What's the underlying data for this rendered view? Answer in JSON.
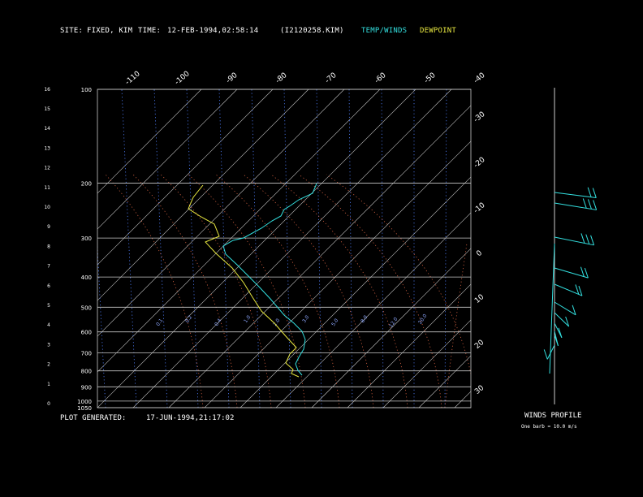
{
  "header": {
    "site_label": "SITE:",
    "site_value": "FIXED, KIM",
    "time_label": "TIME:",
    "time_value": "12-FEB-1994,02:58:14",
    "file": "(I2120258.KIM)",
    "legend_temp": "TEMP/WINDS",
    "legend_dew": "DEWPOINT"
  },
  "footer": {
    "generated_label": "PLOT GENERATED:",
    "generated_value": "17-JUN-1994,21:17:02",
    "winds_title": "WINDS PROFILE",
    "barb_note": "One barb = 10.0 m/s"
  },
  "colors": {
    "temp": "#33e0e0",
    "dew": "#e8e840",
    "grid": "#c8c8c8",
    "mixing": "#5080ff",
    "adiabat": "#d06040"
  },
  "chart_data": {
    "type": "line",
    "title": "",
    "xlabel": "",
    "ylabel": "",
    "grid": true,
    "pressure_levels": [
      100,
      200,
      300,
      400,
      500,
      600,
      700,
      800,
      900,
      1000,
      1050
    ],
    "height_ticks": [
      0,
      1,
      2,
      3,
      4,
      5,
      6,
      7,
      8,
      9,
      10,
      11,
      12,
      13,
      14,
      15,
      16
    ],
    "top_temp_labels": [
      -110,
      -100,
      -90,
      -80,
      -70,
      -60,
      -50,
      -40
    ],
    "right_temp_labels": [
      -30,
      -20,
      -10,
      0,
      10,
      20,
      30
    ],
    "mixing_ratio_labels": [
      "0.1",
      "0.2",
      "0.4",
      "1.0",
      "2.0",
      "3.0",
      "5.0",
      "8.0",
      "12.0",
      "20.0"
    ],
    "series": [
      {
        "name": "TEMP/WINDS",
        "points": [
          [
            390,
            226
          ],
          [
            385,
            238
          ],
          [
            368,
            246
          ],
          [
            358,
            253
          ],
          [
            350,
            258
          ],
          [
            346,
            266
          ],
          [
            335,
            272
          ],
          [
            322,
            281
          ],
          [
            300,
            293
          ],
          [
            287,
            296
          ],
          [
            275,
            303
          ],
          [
            278,
            313
          ],
          [
            292,
            326
          ],
          [
            306,
            340
          ],
          [
            318,
            352
          ],
          [
            333,
            368
          ],
          [
            350,
            388
          ],
          [
            362,
            398
          ],
          [
            372,
            408
          ],
          [
            376,
            418
          ],
          [
            374,
            430
          ],
          [
            368,
            440
          ],
          [
            364,
            448
          ],
          [
            367,
            456
          ],
          [
            372,
            462
          ]
        ]
      },
      {
        "name": "DEWPOINT",
        "points": [
          [
            250,
            228
          ],
          [
            238,
            243
          ],
          [
            232,
            257
          ],
          [
            246,
            266
          ],
          [
            264,
            276
          ],
          [
            270,
            291
          ],
          [
            253,
            298
          ],
          [
            266,
            312
          ],
          [
            286,
            330
          ],
          [
            300,
            348
          ],
          [
            311,
            366
          ],
          [
            322,
            383
          ],
          [
            338,
            398
          ],
          [
            352,
            414
          ],
          [
            365,
            428
          ],
          [
            357,
            436
          ],
          [
            352,
            447
          ],
          [
            361,
            455
          ],
          [
            359,
            460
          ],
          [
            368,
            464
          ]
        ]
      }
    ],
    "winds": [
      {
        "y": 237,
        "dir": 290,
        "spd": 22
      },
      {
        "y": 250,
        "dir": 295,
        "spd": 30
      },
      {
        "y": 292,
        "dir": 300,
        "spd": 27
      },
      {
        "y": 330,
        "dir": 310,
        "spd": 20
      },
      {
        "y": 350,
        "dir": 320,
        "spd": 16
      },
      {
        "y": 372,
        "dir": 330,
        "spd": 14
      },
      {
        "y": 385,
        "dir": 340,
        "spd": 12
      },
      {
        "y": 398,
        "dir": 350,
        "spd": 12
      },
      {
        "y": 408,
        "dir": 355,
        "spd": 10
      },
      {
        "y": 425,
        "dir": 10,
        "spd": 8
      }
    ]
  }
}
